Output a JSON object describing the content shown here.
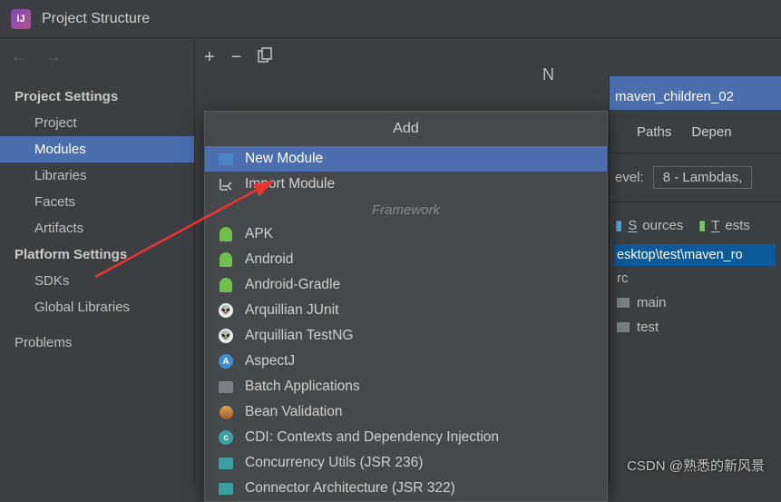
{
  "titlebar": {
    "title": "Project Structure"
  },
  "nav": {
    "back": "←",
    "forward": "→"
  },
  "sidebar": {
    "group1": "Project Settings",
    "items1": [
      "Project",
      "Modules",
      "Libraries",
      "Facets",
      "Artifacts"
    ],
    "selected1": "Modules",
    "group2": "Platform Settings",
    "items2": [
      "SDKs",
      "Global Libraries"
    ],
    "group3_item": "Problems"
  },
  "toolbar": {
    "add": "+",
    "remove": "−",
    "copy_icon": "copy"
  },
  "center_letter": "N",
  "popup": {
    "title": "Add",
    "items_top": [
      {
        "label": "New Module",
        "icon": "folder-blue",
        "selected": true
      },
      {
        "label": "Import Module",
        "icon": "import"
      }
    ],
    "framework_label": "Framework",
    "framework_items": [
      {
        "label": "APK",
        "icon": "android"
      },
      {
        "label": "Android",
        "icon": "android"
      },
      {
        "label": "Android-Gradle",
        "icon": "android"
      },
      {
        "label": "Arquillian JUnit",
        "icon": "helmet"
      },
      {
        "label": "Arquillian TestNG",
        "icon": "helmet"
      },
      {
        "label": "AspectJ",
        "icon": "circle-a"
      },
      {
        "label": "Batch Applications",
        "icon": "folder-gray"
      },
      {
        "label": "Bean Validation",
        "icon": "bean"
      },
      {
        "label": "CDI: Contexts and Dependency Injection",
        "icon": "cdi"
      },
      {
        "label": "Concurrency Utils (JSR 236)",
        "icon": "teal"
      },
      {
        "label": "Connector Architecture (JSR 322)",
        "icon": "teal"
      }
    ]
  },
  "right": {
    "header_text": "maven_children_02",
    "tabs": [
      "Paths",
      "Depen"
    ],
    "level_label": "evel:",
    "level_value": "8 - Lambdas,",
    "sources_btn": "Sources",
    "tests_btn": "Tests",
    "path": "esktop\\test\\maven_ro",
    "tree": [
      "rc",
      "main",
      "test"
    ]
  },
  "watermark": "CSDN @熟悉的新风景"
}
